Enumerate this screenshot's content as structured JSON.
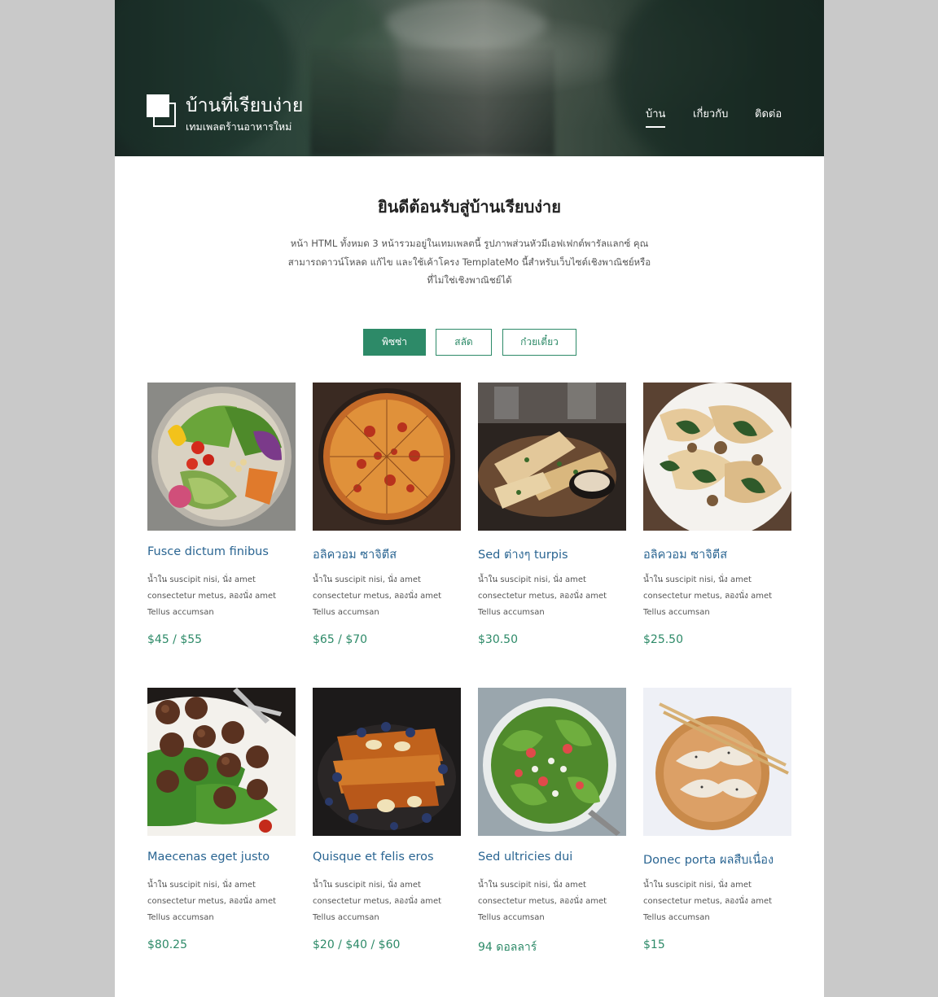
{
  "header": {
    "title": "บ้านที่เรียบง่าย",
    "subtitle": "เทมเพลตร้านอาหารใหม่",
    "nav": [
      {
        "label": "บ้าน",
        "active": true
      },
      {
        "label": "เกี่ยวกับ",
        "active": false
      },
      {
        "label": "ติดต่อ",
        "active": false
      }
    ]
  },
  "intro": {
    "title": "ยินดีต้อนรับสู่บ้านเรียบง่าย",
    "lines": [
      "หน้า HTML ทั้งหมด 3 หน้ารวมอยู่ในเทมเพลตนี้ รูปภาพส่วนหัวมีเอฟเฟกต์พารัลแลกซ์ คุณ",
      "สามารถดาวน์โหลด แก้ไข และใช้เค้าโครง TemplateMo นี้สำหรับเว็บไซต์เชิงพาณิชย์หรือ",
      "ที่ไม่ใช่เชิงพาณิชย์ได้"
    ]
  },
  "tabs": [
    {
      "label": "พิซซ่า",
      "active": true
    },
    {
      "label": "สลัด",
      "active": false
    },
    {
      "label": "ก๋วยเตี๋ยว",
      "active": false
    }
  ],
  "menu_items": [
    {
      "name": "Fusce dictum finibus",
      "desc": [
        "น้ำใน suscipit nisi, นั่ง amet",
        "consectetur metus, ลองนั่ง amet",
        "Tellus accumsan"
      ],
      "price": "$45 / $55",
      "image": "salad-bowl"
    },
    {
      "name": "อลิควอม ซาจิตีส",
      "desc": [
        "น้ำใน suscipit nisi, นั่ง amet",
        "consectetur metus, ลองนั่ง amet",
        "Tellus accumsan"
      ],
      "price": "$65 / $70",
      "image": "pizza"
    },
    {
      "name": "Sed ต่างๆ turpis",
      "desc": [
        "น้ำใน suscipit nisi, นั่ง amet",
        "consectetur metus, ลองนั่ง amet",
        "Tellus accumsan"
      ],
      "price": "$30.50",
      "image": "grilled-dish"
    },
    {
      "name": "อลิควอม ซาจิตีส",
      "desc": [
        "น้ำใน suscipit nisi, นั่ง amet",
        "consectetur metus, ลองนั่ง amet",
        "Tellus accumsan"
      ],
      "price": "$25.50",
      "image": "pasta"
    },
    {
      "name": "Maecenas eget justo",
      "desc": [
        "น้ำใน suscipit nisi, นั่ง amet",
        "consectetur metus, ลองนั่ง amet",
        "Tellus accumsan"
      ],
      "price": "$80.25",
      "image": "meatballs"
    },
    {
      "name": "Quisque et felis eros",
      "desc": [
        "น้ำใน suscipit nisi, นั่ง amet",
        "consectetur metus, ลองนั่ง amet",
        "Tellus accumsan"
      ],
      "price": "$20 / $40 / $60",
      "image": "french-toast"
    },
    {
      "name": "Sed ultricies dui",
      "desc": [
        "น้ำใน suscipit nisi, นั่ง amet",
        "consectetur metus, ลองนั่ง amet",
        "Tellus accumsan"
      ],
      "price": "94 ดอลลาร์",
      "image": "green-salad"
    },
    {
      "name": "Donec porta ผลสืบเนื่อง",
      "desc": [
        "น้ำใน suscipit nisi, นั่ง amet",
        "consectetur metus, ลองนั่ง amet",
        "Tellus accumsan"
      ],
      "price": "$15",
      "image": "dumplings"
    }
  ],
  "colors": {
    "accent": "#2d8a68",
    "item_title": "#2a6592",
    "page_bg": "#c9c9c9"
  }
}
